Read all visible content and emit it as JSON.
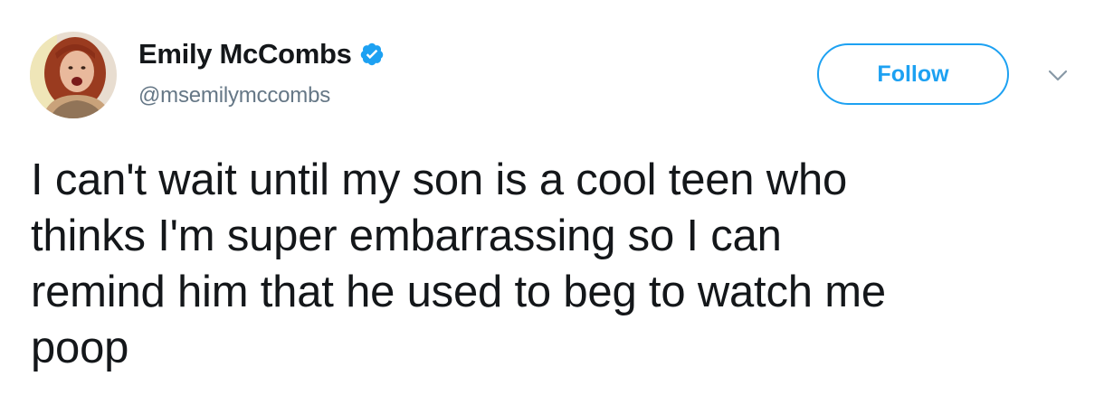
{
  "author": {
    "display_name": "Emily McCombs",
    "handle": "@msemilymccombs",
    "verified": true,
    "avatar_icon": "profile-photo",
    "verified_icon": "verified-badge-icon"
  },
  "actions": {
    "follow_label": "Follow",
    "menu_icon": "chevron-down-icon"
  },
  "tweet": {
    "text": "I can't wait until my son is a cool teen who\nthinks I'm super embarrassing so I can\nremind him that he used to beg to watch me\npoop"
  },
  "colors": {
    "accent": "#1da1f2",
    "text": "#14171a",
    "muted": "#657786"
  }
}
